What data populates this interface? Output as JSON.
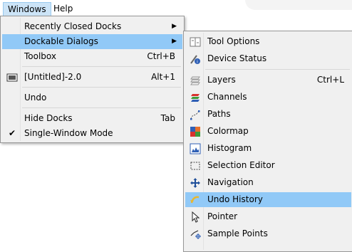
{
  "menubar": {
    "windows": "Windows",
    "help": "Help"
  },
  "windows_menu": {
    "recently_closed": "Recently Closed Docks",
    "dockable_dialogs": "Dockable Dialogs",
    "toolbox": "Toolbox",
    "toolbox_shortcut": "Ctrl+B",
    "untitled": "[Untitled]-2.0",
    "untitled_shortcut": "Alt+1",
    "undo": "Undo",
    "hide_docks": "Hide Docks",
    "hide_docks_shortcut": "Tab",
    "single_window": "Single-Window Mode"
  },
  "dock_menu": {
    "tool_options": "Tool Options",
    "device_status": "Device Status",
    "layers": "Layers",
    "layers_shortcut": "Ctrl+L",
    "channels": "Channels",
    "paths": "Paths",
    "colormap": "Colormap",
    "histogram": "Histogram",
    "selection_editor": "Selection Editor",
    "navigation": "Navigation",
    "undo_history": "Undo History",
    "pointer": "Pointer",
    "sample_points": "Sample Points"
  },
  "icons": {
    "check": "checkmark-icon",
    "submenu": "submenu-arrow-icon"
  },
  "colors": {
    "highlight": "#91c9f7",
    "menu_bg": "#f0f0f0"
  }
}
